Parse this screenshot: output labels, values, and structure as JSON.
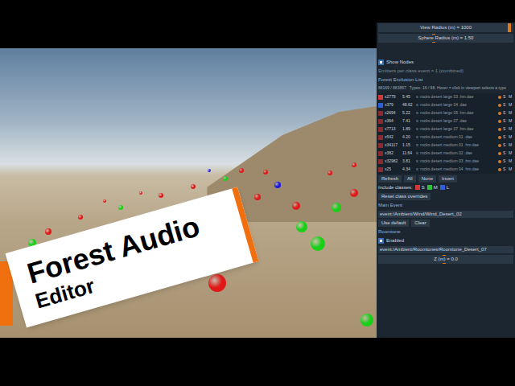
{
  "viewport": {
    "overlay": {
      "title": "Forest Audio",
      "subtitle": "Editor"
    }
  },
  "panel": {
    "sliders": [
      {
        "label": "View Radius (m) = 1000",
        "level": 0.98
      },
      {
        "label": "Sphere Radius (m) = 1.50",
        "level": 0.42
      }
    ],
    "show_nodes": {
      "label": "Show Nodes",
      "checked": true
    },
    "emitters_note": "Emitters per class event = 1 (combined)",
    "exclusion": {
      "title": "Forest Exclusion List",
      "count": "88169 / 883857",
      "hint": "Types: 16 / 98. Hover = click in viewport selects a type",
      "rows": [
        {
          "id": "x2779",
          "value": "5.45",
          "name": "s: rocks desert large 03 .hm.dae",
          "color": "#d23a3a",
          "s": "S",
          "m": "M"
        },
        {
          "id": "x379",
          "value": "48.62",
          "name": "s: rocks desert large 04 .dae",
          "color": "#2f5fd8",
          "s": "S",
          "m": "M"
        },
        {
          "id": "x2694",
          "value": "5.22",
          "name": "s: rocks desert large 05 .hm.dae",
          "color": "#8a2a2e",
          "s": "S",
          "m": "M"
        },
        {
          "id": "x364",
          "value": "7.41",
          "name": "s: rocks desert large 07 .dae",
          "color": "#8a2a2e",
          "s": "S",
          "m": "M"
        },
        {
          "id": "x7713",
          "value": "1.89",
          "name": "s: rocks desert large 07 .hm.dae",
          "color": "#8a2a2e",
          "s": "S",
          "m": "M"
        },
        {
          "id": "x542",
          "value": "4.20",
          "name": "s: rocks desert medium 01 .dae",
          "color": "#8a2a2e",
          "s": "S",
          "m": "M"
        },
        {
          "id": "x34117",
          "value": "1.15",
          "name": "s: rocks desert medium 01 .hm.dae",
          "color": "#8a2a2e",
          "s": "S",
          "m": "M"
        },
        {
          "id": "x382",
          "value": "11.64",
          "name": "s: rocks desert medium 02 .dae",
          "color": "#8a2a2e",
          "s": "S",
          "m": "M"
        },
        {
          "id": "x32982",
          "value": "3.81",
          "name": "s: rocks desert medium 03 .hm.dae",
          "color": "#8a2a2e",
          "s": "S",
          "m": "M"
        },
        {
          "id": "x25",
          "value": "4.34",
          "name": "s: rocks desert medium 04 .hm.dae",
          "color": "#8a2a2e",
          "s": "S",
          "m": "M"
        }
      ]
    },
    "list_buttons": [
      "Refresh",
      "All",
      "None",
      "Invert"
    ],
    "include": {
      "label": "Include classes:",
      "classes": [
        {
          "label": "S",
          "color": "#d23a3a",
          "checked": true
        },
        {
          "label": "M",
          "color": "#2fbf3a",
          "checked": true
        },
        {
          "label": "L",
          "color": "#2f5fd8",
          "checked": true
        }
      ]
    },
    "reset": "Reset class overrides",
    "main_event": {
      "title": "Main Event",
      "value": "event:/Ambient/Wind/Wind_Desert_02",
      "buttons": [
        "Use default",
        "Clear"
      ]
    },
    "roomtone": {
      "title": "Roomtone",
      "enabled": {
        "label": "Enabled",
        "checked": true
      },
      "value": "event:/Ambient/Roomtones/Roomtone_Desert_07",
      "slider": {
        "label": "Z (m) = 0.0",
        "level": 0.5
      }
    }
  }
}
